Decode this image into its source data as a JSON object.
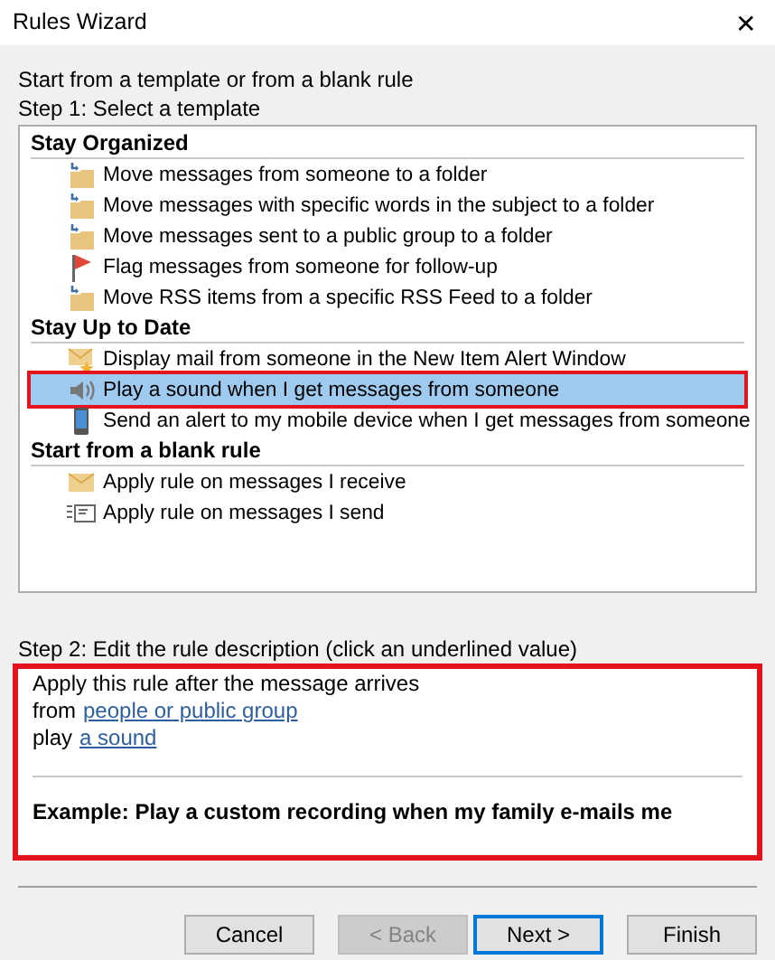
{
  "window": {
    "title": "Rules Wizard",
    "close": "✕"
  },
  "intro": "Start from a template or from a blank rule",
  "step1": "Step 1: Select a template",
  "groups": [
    {
      "title": "Stay Organized",
      "items": [
        {
          "label": "Move messages from someone to a folder",
          "kind": "move",
          "selected": false
        },
        {
          "label": "Move messages with specific words in the subject to a folder",
          "kind": "move",
          "selected": false
        },
        {
          "label": "Move messages sent to a public group to a folder",
          "kind": "move",
          "selected": false
        },
        {
          "label": "Flag messages from someone for follow-up",
          "kind": "flag",
          "selected": false
        },
        {
          "label": "Move RSS items from a specific RSS Feed to a folder",
          "kind": "move",
          "selected": false
        }
      ]
    },
    {
      "title": "Stay Up to Date",
      "items": [
        {
          "label": "Display mail from someone in the New Item Alert Window",
          "kind": "alert",
          "selected": false
        },
        {
          "label": "Play a sound when I get messages from someone",
          "kind": "sound",
          "selected": true
        },
        {
          "label": "Send an alert to my mobile device when I get messages from someone",
          "kind": "mobile",
          "selected": false
        }
      ]
    },
    {
      "title": "Start from a blank rule",
      "items": [
        {
          "label": "Apply rule on messages I receive",
          "kind": "receive",
          "selected": false
        },
        {
          "label": "Apply rule on messages I send",
          "kind": "send",
          "selected": false
        }
      ]
    }
  ],
  "step2": "Step 2: Edit the rule description (click an underlined value)",
  "description": {
    "lines": [
      {
        "text": "Apply this rule after the message arrives"
      },
      {
        "text": "from",
        "link": "people or public group"
      },
      {
        "text": "play",
        "link": "a sound"
      }
    ],
    "example": "Example: Play a custom recording when my family e-mails me"
  },
  "buttons": [
    {
      "label": "Cancel",
      "disabled": false,
      "default": false
    },
    {
      "label": "< Back",
      "disabled": true,
      "default": false
    },
    {
      "label": "Next >",
      "disabled": false,
      "default": true
    },
    {
      "label": "Finish",
      "disabled": false,
      "default": false
    }
  ]
}
